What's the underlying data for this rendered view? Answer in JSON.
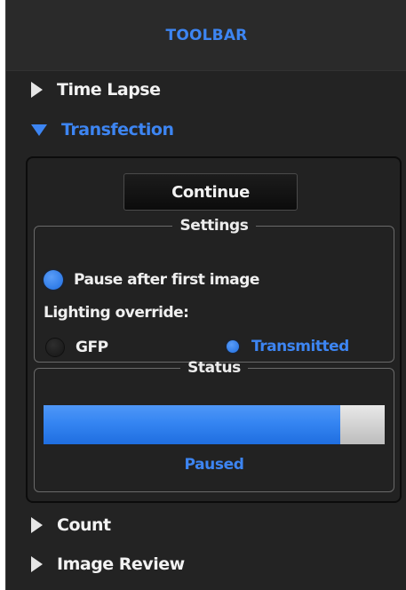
{
  "toolbar": {
    "title": "TOOLBAR"
  },
  "sections": {
    "time_lapse": {
      "label": "Time Lapse",
      "expanded": false
    },
    "transfection": {
      "label": "Transfection",
      "expanded": true
    },
    "count": {
      "label": "Count",
      "expanded": false
    },
    "image_review": {
      "label": "Image Review",
      "expanded": false
    }
  },
  "transfection": {
    "continue_label": "Continue",
    "settings": {
      "legend": "Settings",
      "pause_after_first_image": {
        "label": "Pause after first image",
        "checked": true
      },
      "lighting_override_label": "Lighting override:",
      "lighting_options": [
        {
          "label": "GFP",
          "selected": false
        },
        {
          "label": "Transmitted",
          "selected": true
        }
      ]
    },
    "status": {
      "legend": "Status",
      "progress_fraction": 0.87,
      "text": "Paused"
    }
  },
  "colors": {
    "accent": "#3d85f2",
    "panel_bg": "#232323",
    "text": "#f0f0f0",
    "progress_track": "#d0d0d0"
  },
  "icons": {
    "collapsed": "triangle-right-icon",
    "expanded": "triangle-down-icon"
  }
}
